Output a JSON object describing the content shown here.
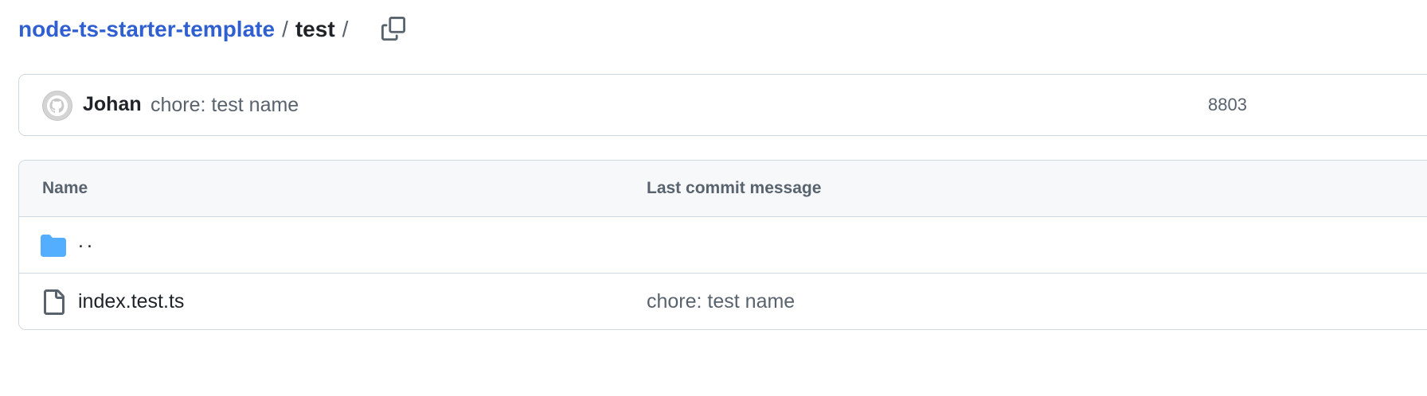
{
  "breadcrumb": {
    "repo": "node-ts-starter-template",
    "separator": "/",
    "current": "test",
    "trailing_separator": "/",
    "copy_icon": "copy-icon"
  },
  "latest_commit": {
    "author": "Johan",
    "message": "chore: test name",
    "sha": "8803",
    "avatar_icon": "github-octocat-icon"
  },
  "file_table": {
    "columns": [
      "Name",
      "Last commit message"
    ],
    "rows": [
      {
        "name": "..",
        "icon": "folder-icon",
        "commit_message": ""
      },
      {
        "name": "index.test.ts",
        "icon": "file-icon",
        "commit_message": "chore: test name"
      }
    ]
  },
  "colors": {
    "link": "#2f5fd0",
    "folder": "#54aeff",
    "muted": "#59636e",
    "border": "#d1d9e0",
    "header_bg": "#f6f8fa"
  }
}
